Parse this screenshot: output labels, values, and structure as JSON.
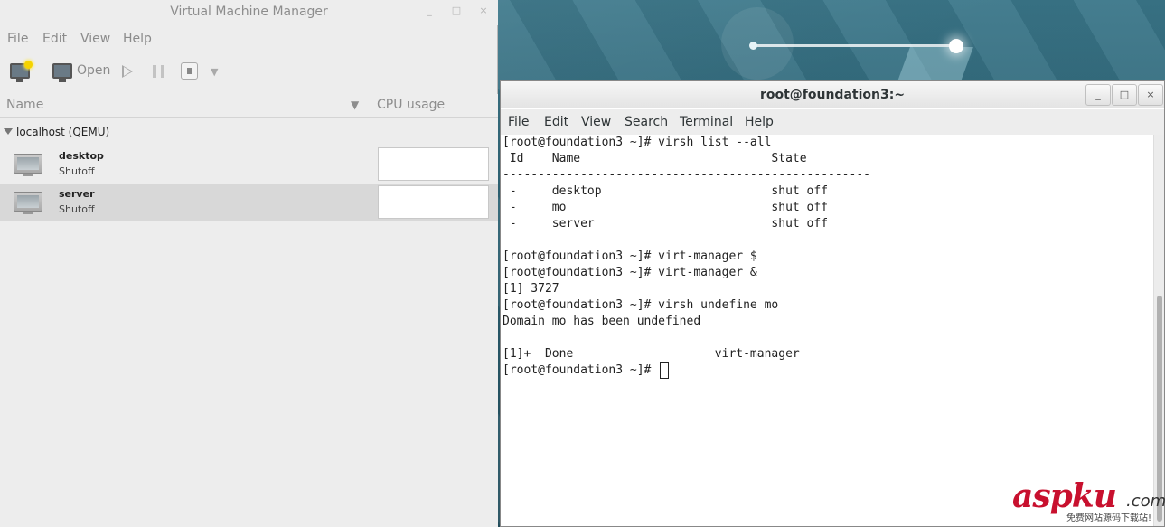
{
  "vmm": {
    "title": "Virtual Machine Manager",
    "window_controls": [
      "_",
      "□",
      "×"
    ],
    "menu": [
      "File",
      "Edit",
      "View",
      "Help"
    ],
    "toolbar": {
      "open_label": "Open"
    },
    "columns": {
      "name": "Name",
      "cpu": "CPU usage"
    },
    "group": "localhost (QEMU)",
    "vms": [
      {
        "name": "desktop",
        "state": "Shutoff",
        "selected": false
      },
      {
        "name": "server",
        "state": "Shutoff",
        "selected": true
      }
    ]
  },
  "terminal": {
    "title": "root@foundation3:~",
    "window_controls": [
      "_",
      "□",
      "×"
    ],
    "menu": [
      "File",
      "Edit",
      "View",
      "Search",
      "Terminal",
      "Help"
    ],
    "lines": [
      "[root@foundation3 ~]# virsh list --all",
      " Id    Name                           State",
      "----------------------------------------------------",
      " -     desktop                        shut off",
      " -     mo                             shut off",
      " -     server                         shut off",
      "",
      "[root@foundation3 ~]# virt-manager $",
      "[root@foundation3 ~]# virt-manager &",
      "[1] 3727",
      "[root@foundation3 ~]# virsh undefine mo",
      "Domain mo has been undefined",
      "",
      "[1]+  Done                    virt-manager"
    ],
    "prompt": "[root@foundation3 ~]# "
  },
  "watermark": {
    "brand": "aspku",
    "suffix": ".com",
    "subtitle": "免费网站源码下载站!"
  }
}
